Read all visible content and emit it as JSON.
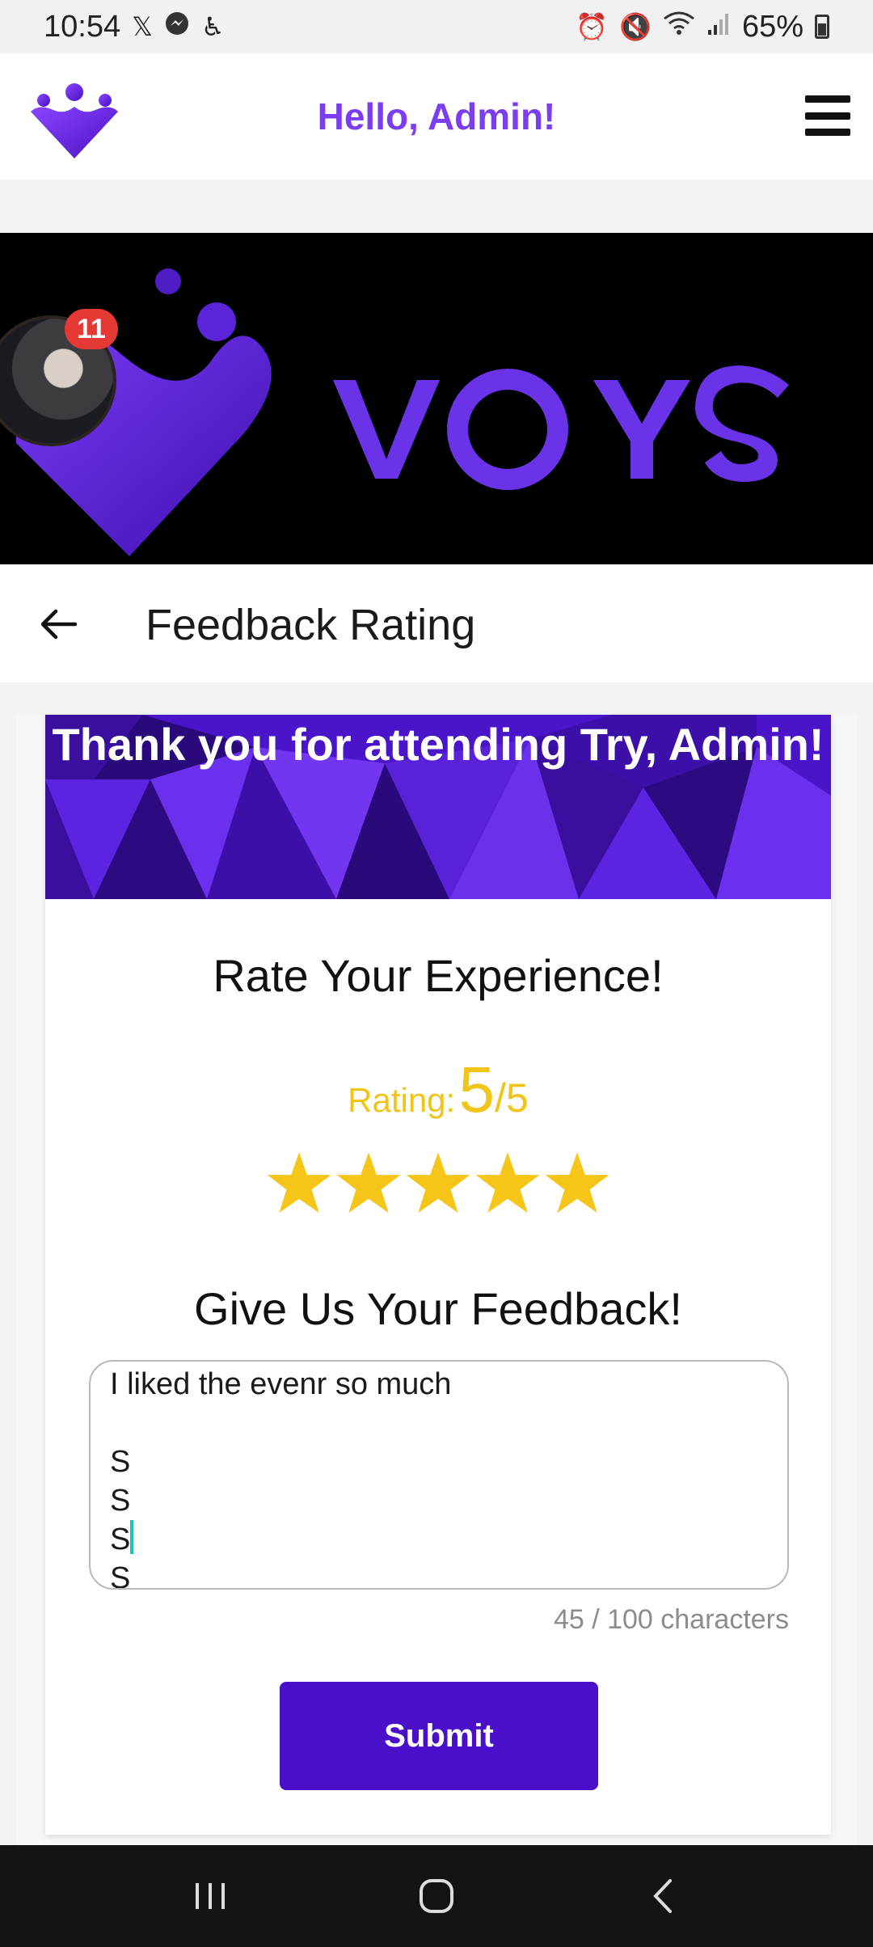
{
  "status_bar": {
    "time": "10:54",
    "battery": "65%",
    "left_icons": [
      "x-icon",
      "messenger-icon",
      "accessibility-icon"
    ],
    "right_icons": [
      "alarm-icon",
      "mute-icon",
      "wifi-icon",
      "signal-icon",
      "battery-icon"
    ]
  },
  "header": {
    "greeting": "Hello, Admin!",
    "logo_icon": "voys-logo-icon",
    "menu_icon": "hamburger-menu-icon",
    "brand_color": "#7a3df0"
  },
  "banner": {
    "brand_text": "VOYS",
    "notification_count": "11"
  },
  "page": {
    "title": "Feedback Rating",
    "back_icon": "arrow-left-icon"
  },
  "card": {
    "thanks_text": "Thank you for attending Try, Admin!",
    "rate_heading": "Rate Your Experience!",
    "rating_label": "Rating:",
    "rating_value": "5",
    "rating_max": "/5",
    "stars_filled": 5,
    "stars_total": 5,
    "star_color": "#f5c518",
    "feedback_heading": "Give Us Your Feedback!",
    "feedback_lines": [
      "I liked the evenr so much",
      "",
      "S",
      "S",
      "S",
      "S"
    ],
    "char_count": "45 / 100 characters",
    "submit_label": "Submit",
    "submit_color": "#4a0fc9"
  },
  "nav_bar": {
    "icons": [
      "recent-apps-icon",
      "home-icon",
      "back-icon"
    ]
  }
}
